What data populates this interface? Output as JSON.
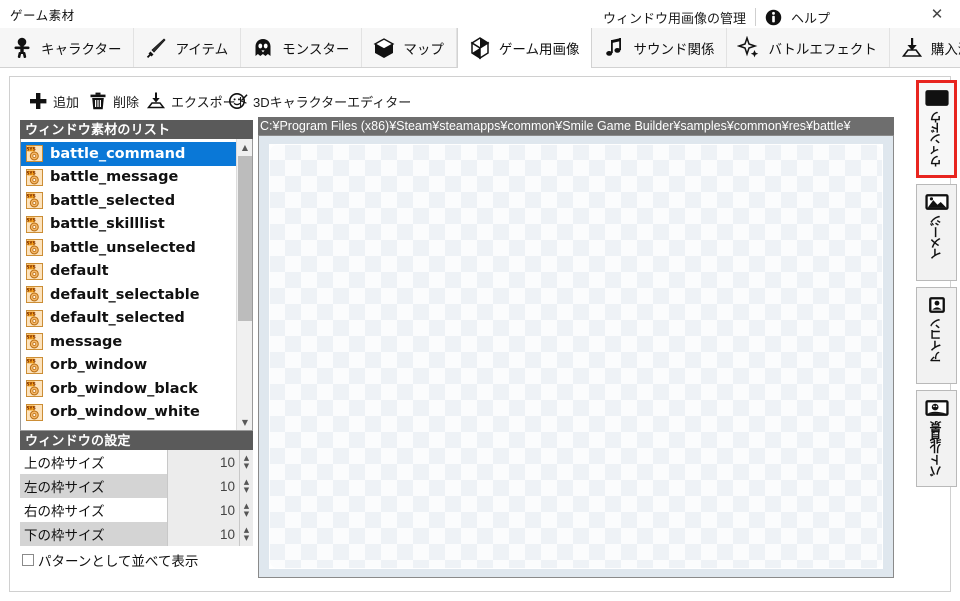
{
  "window": {
    "title": "ゲーム素材",
    "close_label": "✕"
  },
  "tabs": [
    {
      "label": "キャラクター",
      "icon": "character-icon",
      "active": false
    },
    {
      "label": "アイテム",
      "icon": "sword-item-icon",
      "active": false
    },
    {
      "label": "モンスター",
      "icon": "monster-ghost-icon",
      "active": false
    },
    {
      "label": "マップ",
      "icon": "map-book-icon",
      "active": false
    },
    {
      "label": "ゲーム用画像",
      "icon": "open-box-icon",
      "active": true
    },
    {
      "label": "サウンド関係",
      "icon": "music-note-icon",
      "active": false
    },
    {
      "label": "バトルエフェクト",
      "icon": "sparkle-star-icon",
      "active": false
    },
    {
      "label": "購入済みDLC",
      "icon": "download-tray-icon",
      "active": false
    }
  ],
  "toolbar": {
    "add_label": "追加",
    "delete_label": "削除",
    "export_label": "エクスポート",
    "editor3d_label": "3Dキャラクターエディター",
    "manage_label": "ウィンドウ用画像の管理",
    "help_label": "ヘルプ"
  },
  "list": {
    "header": "ウィンドウ素材のリスト",
    "items": [
      {
        "name": "battle_command",
        "selected": true
      },
      {
        "name": "battle_message",
        "selected": false
      },
      {
        "name": "battle_selected",
        "selected": false
      },
      {
        "name": "battle_skilllist",
        "selected": false
      },
      {
        "name": "battle_unselected",
        "selected": false
      },
      {
        "name": "default",
        "selected": false
      },
      {
        "name": "default_selectable",
        "selected": false
      },
      {
        "name": "default_selected",
        "selected": false
      },
      {
        "name": "message",
        "selected": false
      },
      {
        "name": "orb_window",
        "selected": false
      },
      {
        "name": "orb_window_black",
        "selected": false
      },
      {
        "name": "orb_window_white",
        "selected": false
      }
    ],
    "scroll_up": "▲",
    "scroll_down": "▼"
  },
  "settings": {
    "header": "ウィンドウの設定",
    "rows": [
      {
        "label": "上の枠サイズ",
        "value": "10"
      },
      {
        "label": "左の枠サイズ",
        "value": "10"
      },
      {
        "label": "右の枠サイズ",
        "value": "10"
      },
      {
        "label": "下の枠サイズ",
        "value": "10"
      }
    ],
    "checkbox_label": "パターンとして並べて表示",
    "checkbox_checked": false
  },
  "preview": {
    "path": "C:¥Program Files (x86)¥Steam¥steamapps¥common¥Smile Game Builder¥samples¥common¥res¥battle¥"
  },
  "side_tabs": [
    {
      "label": "ウィンドウ",
      "icon": "window-black-icon",
      "active": true
    },
    {
      "label": "イメージ",
      "icon": "image-picture-icon",
      "active": false
    },
    {
      "label": "アイコン",
      "icon": "icon-badge-icon",
      "active": false
    },
    {
      "label": "バトル背景",
      "icon": "battle-background-icon",
      "active": false
    }
  ],
  "colors": {
    "selection_blue": "#0a78d7",
    "header_gray": "#5a5a5a",
    "active_red": "#e8251f",
    "path_bar": "#6e6e6e"
  }
}
